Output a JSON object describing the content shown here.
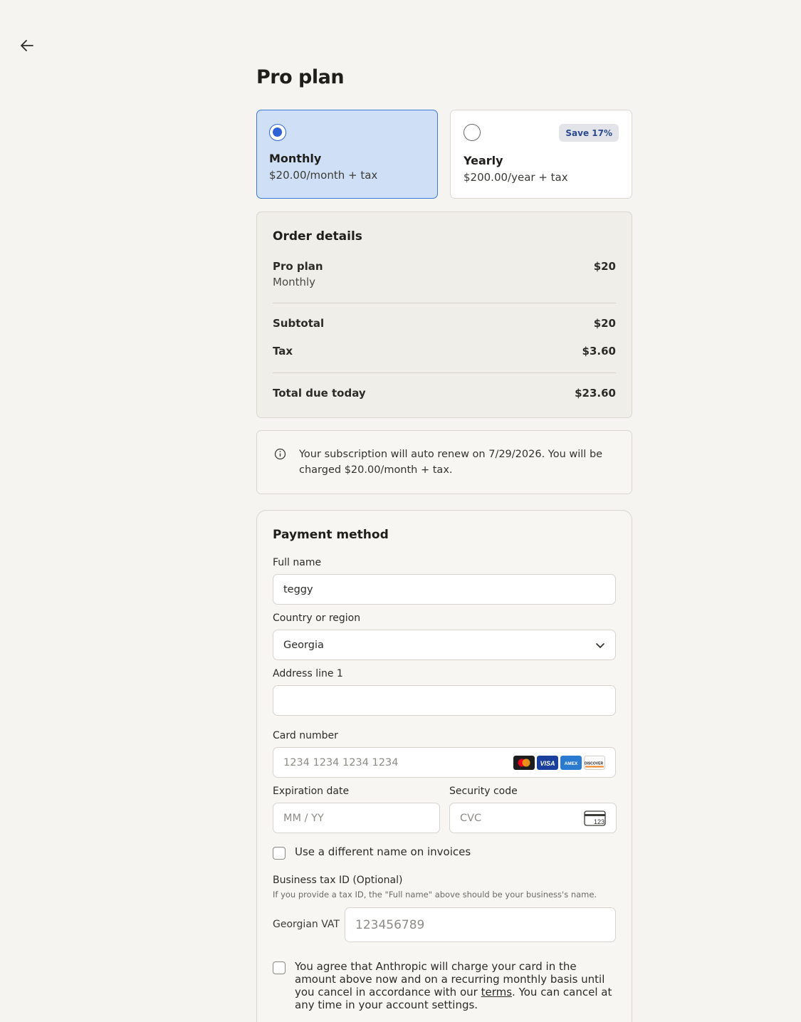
{
  "nav": {
    "back_icon": "arrow-left-icon"
  },
  "page": {
    "title": "Pro plan"
  },
  "plans": {
    "monthly": {
      "name": "Monthly",
      "price": "$20.00/month + tax",
      "selected": true
    },
    "yearly": {
      "name": "Yearly",
      "price": "$200.00/year + tax",
      "badge": "Save 17%",
      "selected": false
    }
  },
  "order": {
    "title": "Order details",
    "item_name": "Pro plan",
    "item_period": "Monthly",
    "item_price": "$20",
    "subtotal_label": "Subtotal",
    "subtotal_value": "$20",
    "tax_label": "Tax",
    "tax_value": "$3.60",
    "total_label": "Total due today",
    "total_value": "$23.60"
  },
  "info": {
    "icon": "info-icon",
    "text": "Your subscription will auto renew on 7/29/2026. You will be charged $20.00/month + tax."
  },
  "payment": {
    "title": "Payment method",
    "full_name_label": "Full name",
    "full_name_value": "teggy",
    "country_label": "Country or region",
    "country_value": "Georgia",
    "address_label": "Address line 1",
    "address_value": "",
    "card_label": "Card number",
    "card_placeholder": "1234 1234 1234 1234",
    "card_brands": [
      "Mastercard",
      "Visa",
      "Amex",
      "Discover"
    ],
    "expiry_label": "Expiration date",
    "expiry_placeholder": "MM / YY",
    "cvc_label": "Security code",
    "cvc_placeholder": "CVC",
    "cvc_icon_text": "123",
    "diff_name_label": "Use a different name on invoices",
    "tax_id_label": "Business tax ID (Optional)",
    "tax_id_note": "If you provide a tax ID, the \"Full name\" above should be your business's name.",
    "vat_label": "Georgian VAT",
    "vat_placeholder": "123456789",
    "agree_text_before": "You agree that Anthropic will charge your card in the amount above now and on a recurring monthly basis until you cancel in accordance with our ",
    "agree_link": "terms",
    "agree_text_after": ". You can cancel at any time in your account settings."
  },
  "colors": {
    "accent": "#2f62d6",
    "selected_bg": "#cfe0f6",
    "page_bg": "#f5f4f0"
  }
}
